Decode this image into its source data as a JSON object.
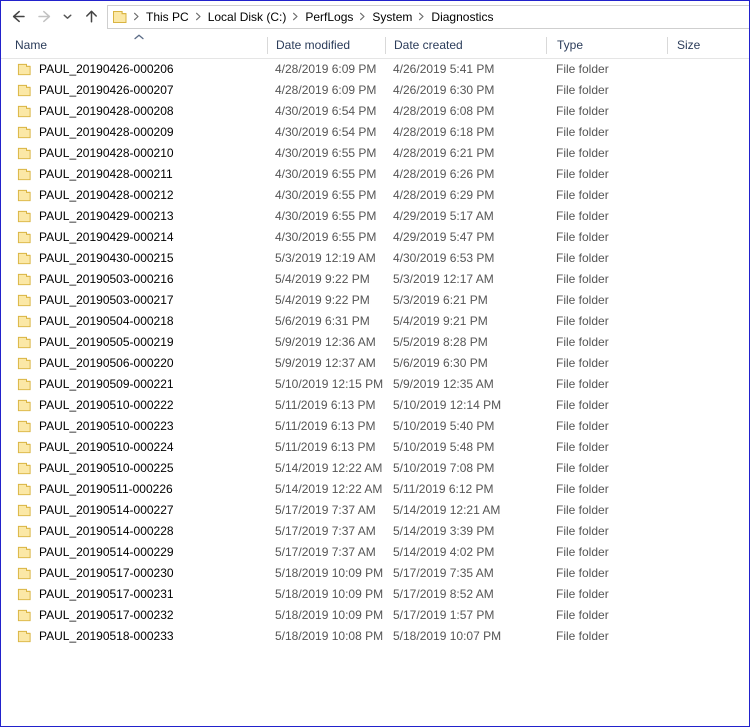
{
  "navbar": {
    "back_icon": "arrow-left-icon",
    "forward_icon": "arrow-right-icon",
    "recent_icon": "chevron-down-icon",
    "up_icon": "arrow-up-icon",
    "address_folder_icon": "folder-icon",
    "breadcrumbs": [
      "This PC",
      "Local Disk (C:)",
      "PerfLogs",
      "System",
      "Diagnostics"
    ],
    "separator_glyph": "›"
  },
  "columns": {
    "name": "Name",
    "date_modified": "Date modified",
    "date_created": "Date created",
    "type": "Type",
    "size": "Size",
    "sort_indicator": "chevron-up-icon",
    "sort_column": "Name",
    "sort_direction": "ascending"
  },
  "colors": {
    "window_border": "#2222cc",
    "header_text": "#2b3c5a",
    "row_secondary_text": "#555555",
    "folder_fill": "#fbe8a6",
    "folder_stroke": "#d9b441",
    "divider": "#d9d9d9"
  },
  "files": [
    {
      "name": "PAUL_20190426-000206",
      "modified": "4/28/2019 6:09 PM",
      "created": "4/26/2019 5:41 PM",
      "type": "File folder",
      "size": "",
      "icon": "folder-icon"
    },
    {
      "name": "PAUL_20190426-000207",
      "modified": "4/28/2019 6:09 PM",
      "created": "4/26/2019 6:30 PM",
      "type": "File folder",
      "size": "",
      "icon": "folder-icon"
    },
    {
      "name": "PAUL_20190428-000208",
      "modified": "4/30/2019 6:54 PM",
      "created": "4/28/2019 6:08 PM",
      "type": "File folder",
      "size": "",
      "icon": "folder-icon"
    },
    {
      "name": "PAUL_20190428-000209",
      "modified": "4/30/2019 6:54 PM",
      "created": "4/28/2019 6:18 PM",
      "type": "File folder",
      "size": "",
      "icon": "folder-icon"
    },
    {
      "name": "PAUL_20190428-000210",
      "modified": "4/30/2019 6:55 PM",
      "created": "4/28/2019 6:21 PM",
      "type": "File folder",
      "size": "",
      "icon": "folder-icon"
    },
    {
      "name": "PAUL_20190428-000211",
      "modified": "4/30/2019 6:55 PM",
      "created": "4/28/2019 6:26 PM",
      "type": "File folder",
      "size": "",
      "icon": "folder-icon"
    },
    {
      "name": "PAUL_20190428-000212",
      "modified": "4/30/2019 6:55 PM",
      "created": "4/28/2019 6:29 PM",
      "type": "File folder",
      "size": "",
      "icon": "folder-icon"
    },
    {
      "name": "PAUL_20190429-000213",
      "modified": "4/30/2019 6:55 PM",
      "created": "4/29/2019 5:17 AM",
      "type": "File folder",
      "size": "",
      "icon": "folder-icon"
    },
    {
      "name": "PAUL_20190429-000214",
      "modified": "4/30/2019 6:55 PM",
      "created": "4/29/2019 5:47 PM",
      "type": "File folder",
      "size": "",
      "icon": "folder-icon"
    },
    {
      "name": "PAUL_20190430-000215",
      "modified": "5/3/2019 12:19 AM",
      "created": "4/30/2019 6:53 PM",
      "type": "File folder",
      "size": "",
      "icon": "folder-icon"
    },
    {
      "name": "PAUL_20190503-000216",
      "modified": "5/4/2019 9:22 PM",
      "created": "5/3/2019 12:17 AM",
      "type": "File folder",
      "size": "",
      "icon": "folder-icon"
    },
    {
      "name": "PAUL_20190503-000217",
      "modified": "5/4/2019 9:22 PM",
      "created": "5/3/2019 6:21 PM",
      "type": "File folder",
      "size": "",
      "icon": "folder-icon"
    },
    {
      "name": "PAUL_20190504-000218",
      "modified": "5/6/2019 6:31 PM",
      "created": "5/4/2019 9:21 PM",
      "type": "File folder",
      "size": "",
      "icon": "folder-icon"
    },
    {
      "name": "PAUL_20190505-000219",
      "modified": "5/9/2019 12:36 AM",
      "created": "5/5/2019 8:28 PM",
      "type": "File folder",
      "size": "",
      "icon": "folder-icon"
    },
    {
      "name": "PAUL_20190506-000220",
      "modified": "5/9/2019 12:37 AM",
      "created": "5/6/2019 6:30 PM",
      "type": "File folder",
      "size": "",
      "icon": "folder-icon"
    },
    {
      "name": "PAUL_20190509-000221",
      "modified": "5/10/2019 12:15 PM",
      "created": "5/9/2019 12:35 AM",
      "type": "File folder",
      "size": "",
      "icon": "folder-icon"
    },
    {
      "name": "PAUL_20190510-000222",
      "modified": "5/11/2019 6:13 PM",
      "created": "5/10/2019 12:14 PM",
      "type": "File folder",
      "size": "",
      "icon": "folder-icon"
    },
    {
      "name": "PAUL_20190510-000223",
      "modified": "5/11/2019 6:13 PM",
      "created": "5/10/2019 5:40 PM",
      "type": "File folder",
      "size": "",
      "icon": "folder-icon"
    },
    {
      "name": "PAUL_20190510-000224",
      "modified": "5/11/2019 6:13 PM",
      "created": "5/10/2019 5:48 PM",
      "type": "File folder",
      "size": "",
      "icon": "folder-icon"
    },
    {
      "name": "PAUL_20190510-000225",
      "modified": "5/14/2019 12:22 AM",
      "created": "5/10/2019 7:08 PM",
      "type": "File folder",
      "size": "",
      "icon": "folder-icon"
    },
    {
      "name": "PAUL_20190511-000226",
      "modified": "5/14/2019 12:22 AM",
      "created": "5/11/2019 6:12 PM",
      "type": "File folder",
      "size": "",
      "icon": "folder-icon"
    },
    {
      "name": "PAUL_20190514-000227",
      "modified": "5/17/2019 7:37 AM",
      "created": "5/14/2019 12:21 AM",
      "type": "File folder",
      "size": "",
      "icon": "folder-icon"
    },
    {
      "name": "PAUL_20190514-000228",
      "modified": "5/17/2019 7:37 AM",
      "created": "5/14/2019 3:39 PM",
      "type": "File folder",
      "size": "",
      "icon": "folder-icon"
    },
    {
      "name": "PAUL_20190514-000229",
      "modified": "5/17/2019 7:37 AM",
      "created": "5/14/2019 4:02 PM",
      "type": "File folder",
      "size": "",
      "icon": "folder-icon"
    },
    {
      "name": "PAUL_20190517-000230",
      "modified": "5/18/2019 10:09 PM",
      "created": "5/17/2019 7:35 AM",
      "type": "File folder",
      "size": "",
      "icon": "folder-icon"
    },
    {
      "name": "PAUL_20190517-000231",
      "modified": "5/18/2019 10:09 PM",
      "created": "5/17/2019 8:52 AM",
      "type": "File folder",
      "size": "",
      "icon": "folder-icon"
    },
    {
      "name": "PAUL_20190517-000232",
      "modified": "5/18/2019 10:09 PM",
      "created": "5/17/2019 1:57 PM",
      "type": "File folder",
      "size": "",
      "icon": "folder-icon"
    },
    {
      "name": "PAUL_20190518-000233",
      "modified": "5/18/2019 10:08 PM",
      "created": "5/18/2019 10:07 PM",
      "type": "File folder",
      "size": "",
      "icon": "folder-icon"
    }
  ]
}
